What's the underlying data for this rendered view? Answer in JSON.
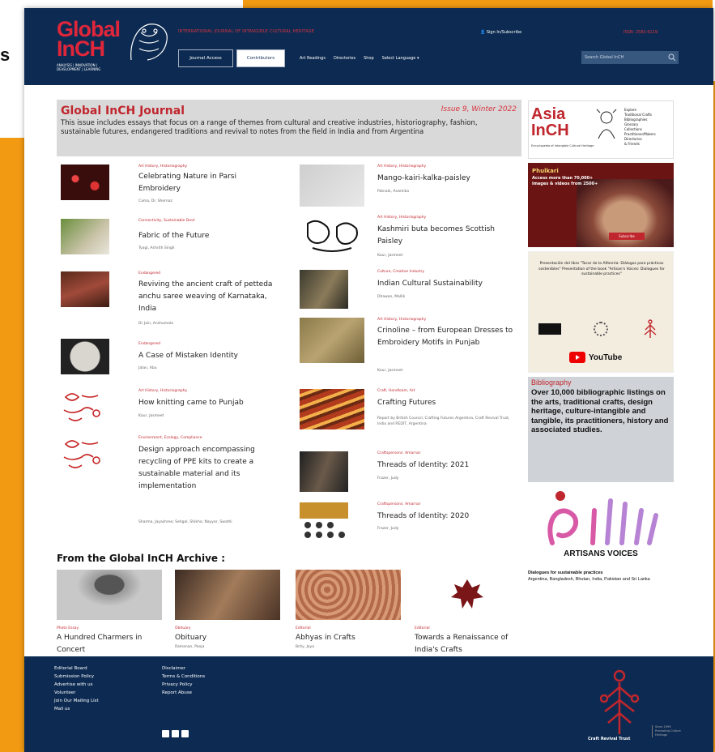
{
  "snippet_char": "s",
  "header": {
    "logo_line1": "Global",
    "logo_line2": "InCH",
    "logo_sub": "ANALYSIS | INNOVATION | DEVELOPMENT | LEARNING",
    "tagline": "INTERNATIONAL JOURNAL OF INTANGIBLE CULTURAL HERITAGE",
    "signin": "Sign In/Subscribe",
    "issn": "ISSN: 2582-6119",
    "nav_buttons": [
      "Journal Access",
      "Contributors"
    ],
    "nav_links": [
      "Art Readings",
      "Directories",
      "Shop",
      "Select Language"
    ],
    "search_placeholder": "Search Global InCH"
  },
  "journal": {
    "title": "Global InCH Journal",
    "issue": "Issue 9, Winter 2022",
    "desc": "This issue includes essays that focus on a range of themes from cultural and creative industries, historiography, fashion, sustainable futures, endangered traditions and revival to notes from the field in India and from Argentina"
  },
  "articles_left": [
    {
      "cat": "Art History, Historiography",
      "title": "Celebrating Nature in Parsi Embroidery",
      "author": "Cama, Dr. Shernaz"
    },
    {
      "cat": "Connectivity, Sustainable Devt",
      "title": "Fabric of the Future",
      "author": "Tyagi, Ashrith Singh"
    },
    {
      "cat": "Endangered",
      "title": "Reviving the ancient craft of petteda anchu saree weaving of Karnataka, India",
      "author": "Dr Jain, Anshumala"
    },
    {
      "cat": "Endangered",
      "title": "A Case of Mistaken Identity",
      "author": "Jalan, Abu"
    },
    {
      "cat": "Art History, Historiography",
      "title": "How knitting came to Punjab",
      "author": "Kaur, Jasmeet"
    },
    {
      "cat": "Environment, Ecology, Compliance",
      "title": "Design approach encompassing recycling of PPE kits to create a sustainable material and its implementation",
      "author": "Sharma, Jayashree; Sehgal, Shikha; Nayyar, Swathi"
    }
  ],
  "articles_right": [
    {
      "cat": "Art History, Historiography",
      "title": "Mango-kairi-kalka-paisley",
      "author": "Patnaik, Anamika"
    },
    {
      "cat": "Art History, Historiography",
      "title": "Kashmiri buta becomes Scottish Paisley",
      "author": "Kaur, Jasmeet"
    },
    {
      "cat": "Culture, Creative Industry",
      "title": "Indian Cultural Sustainability",
      "author": "Dhawan, Mallik"
    },
    {
      "cat": "Art History, Historiography",
      "title": "Crinoline – from European Dresses to Embroidery Motifs in Punjab",
      "author": "Kaur, Jasmeet"
    },
    {
      "cat": "Craft, Handloom, Art",
      "title": "Crafting Futures",
      "author": "Report by British Council, Crafting Futures Argentina, Craft Revival Trust, India and REDIT, Argentina"
    },
    {
      "cat": "Craftspersons: Amarnar",
      "title": "Threads of Identity: 2021",
      "author": "Frazer, Judy"
    },
    {
      "cat": "Craftspersons: Amarnar",
      "title": "Threads of Identity: 2020",
      "author": "Frazer, Judy"
    }
  ],
  "archive": {
    "heading": "From the Global InCH Archive :",
    "items": [
      {
        "cat": "Photo Essay",
        "title": "A Hundred Charmers in Concert",
        "author": "Desai, Neha"
      },
      {
        "cat": "Obituary",
        "title": "Obituary",
        "author": "Ramanan, Pooja"
      },
      {
        "cat": "Editorial",
        "title": "Abhyas in Crafts",
        "author": "Brity, Jaya"
      },
      {
        "cat": "Editorial",
        "title": "Towards a Renaissance of India's Crafts",
        "author": "Brity, Jaya"
      }
    ]
  },
  "sidebar": {
    "asia_t1": "Asia",
    "asia_t2": "InCH",
    "asia_tag": "Encyclopedia of Intangible Cultural Heritage",
    "asia_list": [
      "Explore",
      "Traditional Crafts",
      "Bibliographies",
      "Glossary",
      "Collections",
      "Practitioner/Makers",
      "Directories",
      "& Friends"
    ],
    "phulkari_title": "Phulkari",
    "phulkari_line": "Access more than 70,000+ images & videos from 2500+",
    "phulkari_btn": "Subscribe",
    "pres_text": "Presentación del libro \"Tocar de la Alfarería: Diálogos para prácticas sostenibles\" Presentation of the book \"Artisan's Voices: Dialogues for sustainable practices\"",
    "youtube": "YouTube",
    "bib_h": "Bibliography",
    "bib_b": "Over 10,000 bibliographic listings on the arts, traditional crafts, design heritage, culture-intangible and tangible, its practitioners, history and associated studies.",
    "av_title": "ARTISANS VOICES",
    "av_sub": "Dialogues for sustainable practices",
    "av_countries": "Argentina, Bangladesh, Bhutan, India, Pakistan and Sri Lanka"
  },
  "footer": {
    "col1": [
      "Editorial Board",
      "Submission Policy",
      "Advertise with us",
      "Volunteer",
      "Join Our Mailing List",
      "Mail us"
    ],
    "col2": [
      "Disclaimer",
      "Terms & Conditions",
      "Privacy Policy",
      "Report Abuse"
    ],
    "crt_name": "Craft Revival Trust",
    "crt_side": "Since 1999 Promoting Culture Heritage"
  },
  "colors": {
    "navy": "#0d2b52",
    "red": "#c0262d",
    "orange": "#f29a12"
  }
}
